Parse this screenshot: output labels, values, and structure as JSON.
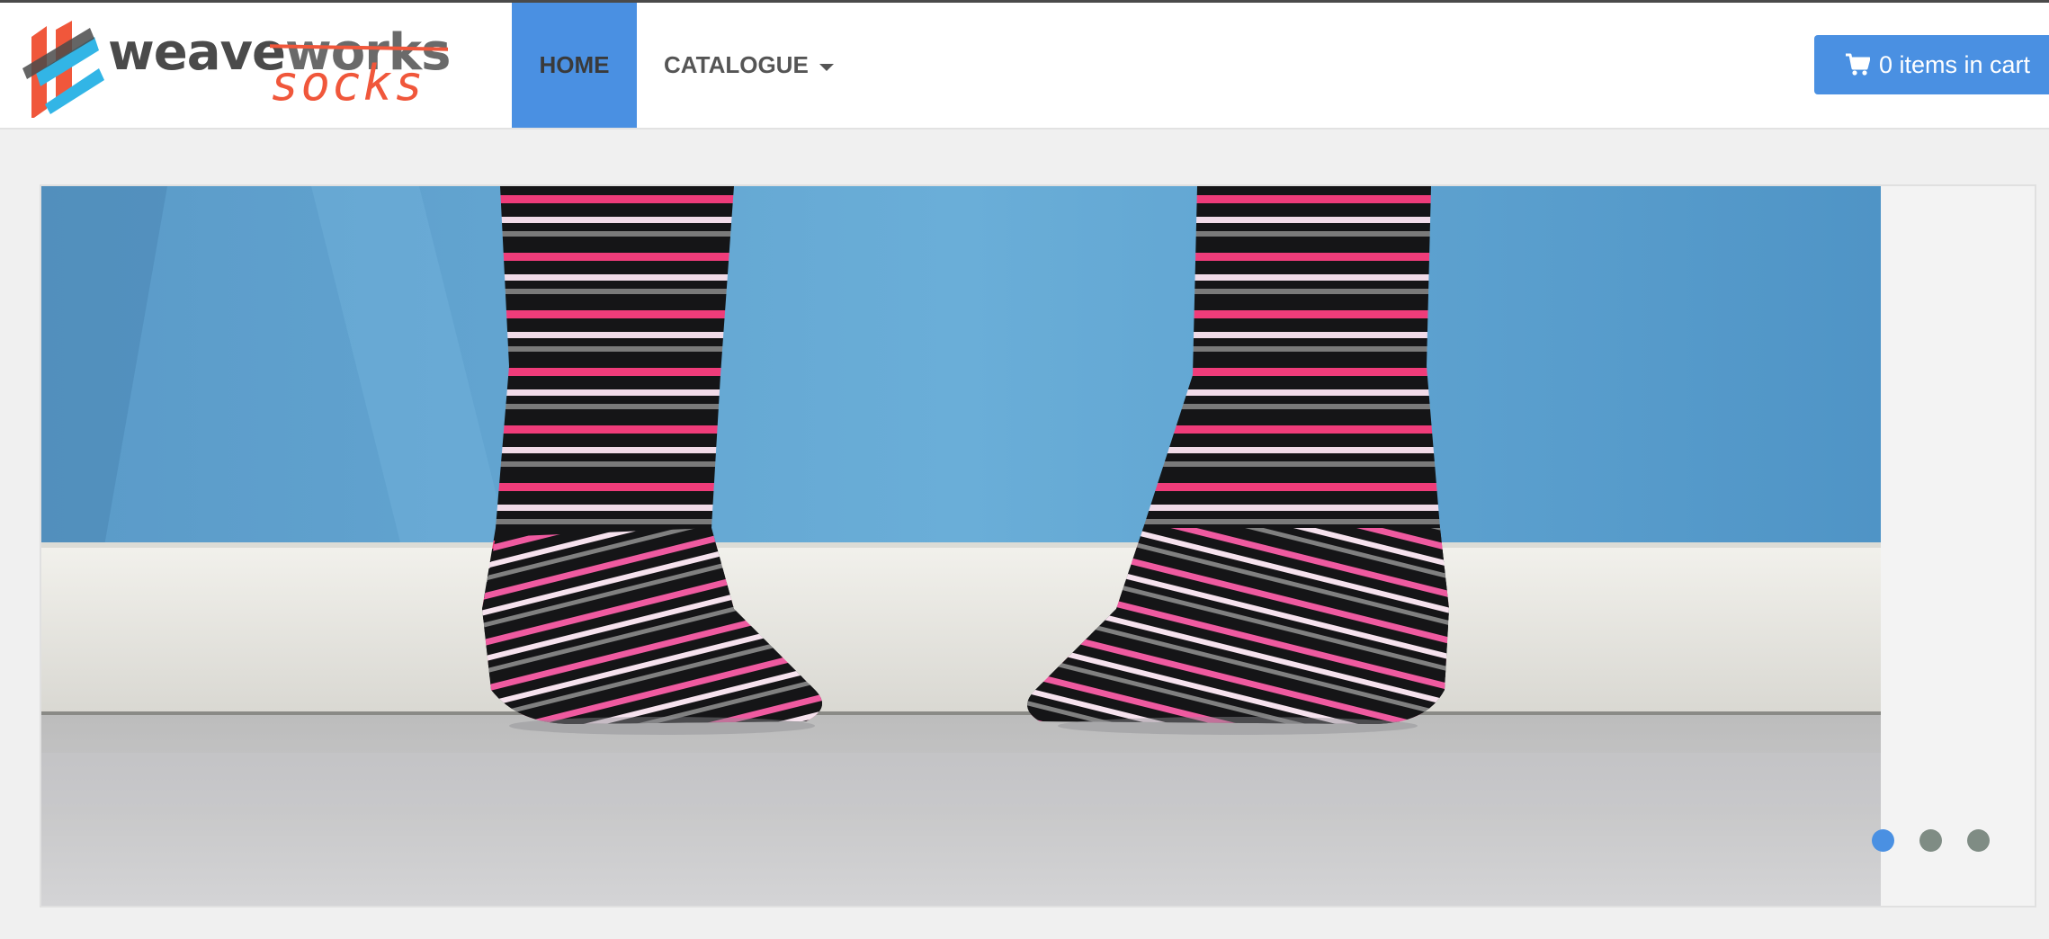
{
  "brand": {
    "name_part1": "weave",
    "name_part2": "works",
    "sub": "socks",
    "logo_icon": "weaveworks-logo-icon"
  },
  "nav": {
    "items": [
      {
        "label": "HOME",
        "active": true
      },
      {
        "label": "CATALOGUE",
        "has_dropdown": true
      }
    ]
  },
  "cart": {
    "label": "0 items in cart",
    "icon": "shopping-cart-icon"
  },
  "carousel": {
    "slide_count": 3,
    "active_index": 0,
    "slide_subject": "striped socks"
  },
  "colors": {
    "accent": "#4a90e2",
    "brand_orange": "#f0573b",
    "dot_inactive": "#7f8c84"
  }
}
